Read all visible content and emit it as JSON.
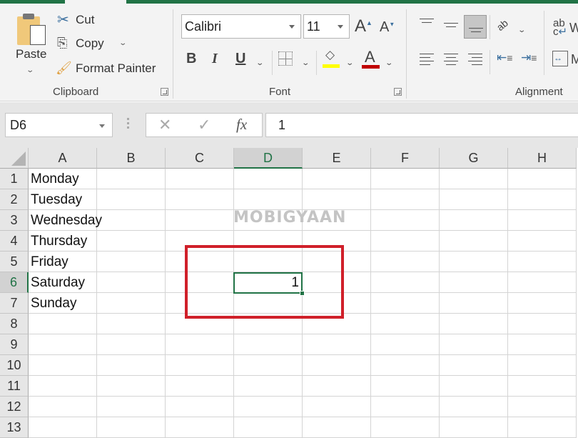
{
  "ribbon": {
    "clipboard": {
      "group_label": "Clipboard",
      "paste_label": "Paste",
      "cut_label": "Cut",
      "copy_label": "Copy",
      "format_painter_label": "Format Painter"
    },
    "font": {
      "group_label": "Font",
      "font_name": "Calibri",
      "font_size": "11",
      "bold_label": "B",
      "italic_label": "I",
      "underline_label": "U",
      "increase_size_label": "A",
      "decrease_size_label": "A",
      "font_color_label": "A",
      "fill_color": "#ffff00",
      "font_color": "#c00000"
    },
    "alignment": {
      "group_label": "Alignment",
      "wrap_text_label": "W",
      "merge_label": "M",
      "orientation_label": "ab"
    }
  },
  "formula_bar": {
    "name_box": "D6",
    "cancel_icon": "✕",
    "enter_icon": "✓",
    "fx_label": "fx",
    "value": "1"
  },
  "sheet": {
    "columns": [
      "A",
      "B",
      "C",
      "D",
      "E",
      "F",
      "G",
      "H"
    ],
    "rows": [
      "1",
      "2",
      "3",
      "4",
      "5",
      "6",
      "7",
      "8",
      "9",
      "10",
      "11",
      "12",
      "13"
    ],
    "selected_column": "D",
    "selected_row": "6",
    "cells": {
      "A1": "Monday",
      "A2": "Tuesday",
      "A3": "Wednesday",
      "A4": "Thursday",
      "A5": "Friday",
      "A6": "Saturday",
      "A7": "Sunday",
      "D6": "1"
    }
  },
  "watermark": "MOBIGYAAN",
  "accent_color": "#217346",
  "highlight_color": "#d0202a"
}
